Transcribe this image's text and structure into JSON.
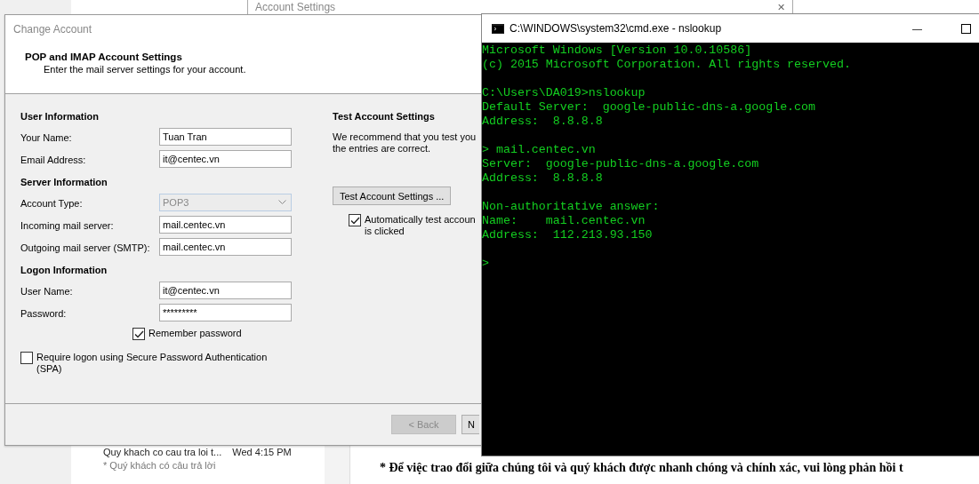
{
  "background_window": {
    "title": "Account Settings",
    "close": "✕"
  },
  "mail_list": {
    "items": [
      {
        "subject": "Quy khach co cau tra loi t...",
        "time": "Wed 4:15 PM",
        "preview": "* Quý khách có câu trả lời"
      }
    ]
  },
  "reading_pane": {
    "text": "* Để việc trao đổi giữa chúng tôi và quý khách được nhanh chóng và chính xác, vui lòng phản hồi t"
  },
  "dialog": {
    "title": "Change Account",
    "heading": "POP and IMAP Account Settings",
    "subtitle": "Enter the mail server settings for your account.",
    "sections": [
      {
        "title": "User Information",
        "fields": [
          {
            "kind": "text",
            "label": "Your Name:",
            "value": "Tuan Tran"
          },
          {
            "kind": "text",
            "label": "Email Address:",
            "value": "it@centec.vn"
          }
        ]
      },
      {
        "title": "Server Information",
        "fields": [
          {
            "kind": "select",
            "label": "Account Type:",
            "value": "POP3",
            "disabled": true
          },
          {
            "kind": "text",
            "label": "Incoming mail server:",
            "value": "mail.centec.vn"
          },
          {
            "kind": "text",
            "label": "Outgoing mail server (SMTP):",
            "value": "mail.centec.vn"
          }
        ]
      },
      {
        "title": "Logon Information",
        "fields": [
          {
            "kind": "text",
            "label": "User Name:",
            "value": "it@centec.vn"
          },
          {
            "kind": "password",
            "label": "Password:",
            "value": "*********"
          }
        ]
      }
    ],
    "remember_password": {
      "label": "Remember password",
      "checked": true
    },
    "spa": {
      "label": "Require logon using Secure Password Authentication (SPA)",
      "checked": false
    },
    "test": {
      "title": "Test Account Settings",
      "lines": [
        "We recommend that you test you",
        "the entries are correct."
      ],
      "button": "Test Account Settings ...",
      "auto_test": {
        "lines": [
          "Automatically test accoun",
          "is clicked"
        ],
        "checked": true
      }
    },
    "buttons": [
      {
        "label": "< Back",
        "disabled": true
      },
      {
        "label": "N",
        "disabled": false
      }
    ]
  },
  "console": {
    "title": "C:\\WINDOWS\\system32\\cmd.exe - nslookup",
    "minimize": "—",
    "blocks": [
      [
        "Microsoft Windows [Version 10.0.10586]",
        "(c) 2015 Microsoft Corporation. All rights reserved."
      ],
      [
        "C:\\Users\\DA019>nslookup",
        "Default Server:  google-public-dns-a.google.com",
        "Address:  8.8.8.8"
      ],
      [
        "> mail.centec.vn",
        "Server:  google-public-dns-a.google.com",
        "Address:  8.8.8.8"
      ],
      [
        "Non-authoritative answer:",
        "Name:    mail.centec.vn",
        "Address:  112.213.93.150"
      ],
      [
        ">"
      ]
    ]
  }
}
